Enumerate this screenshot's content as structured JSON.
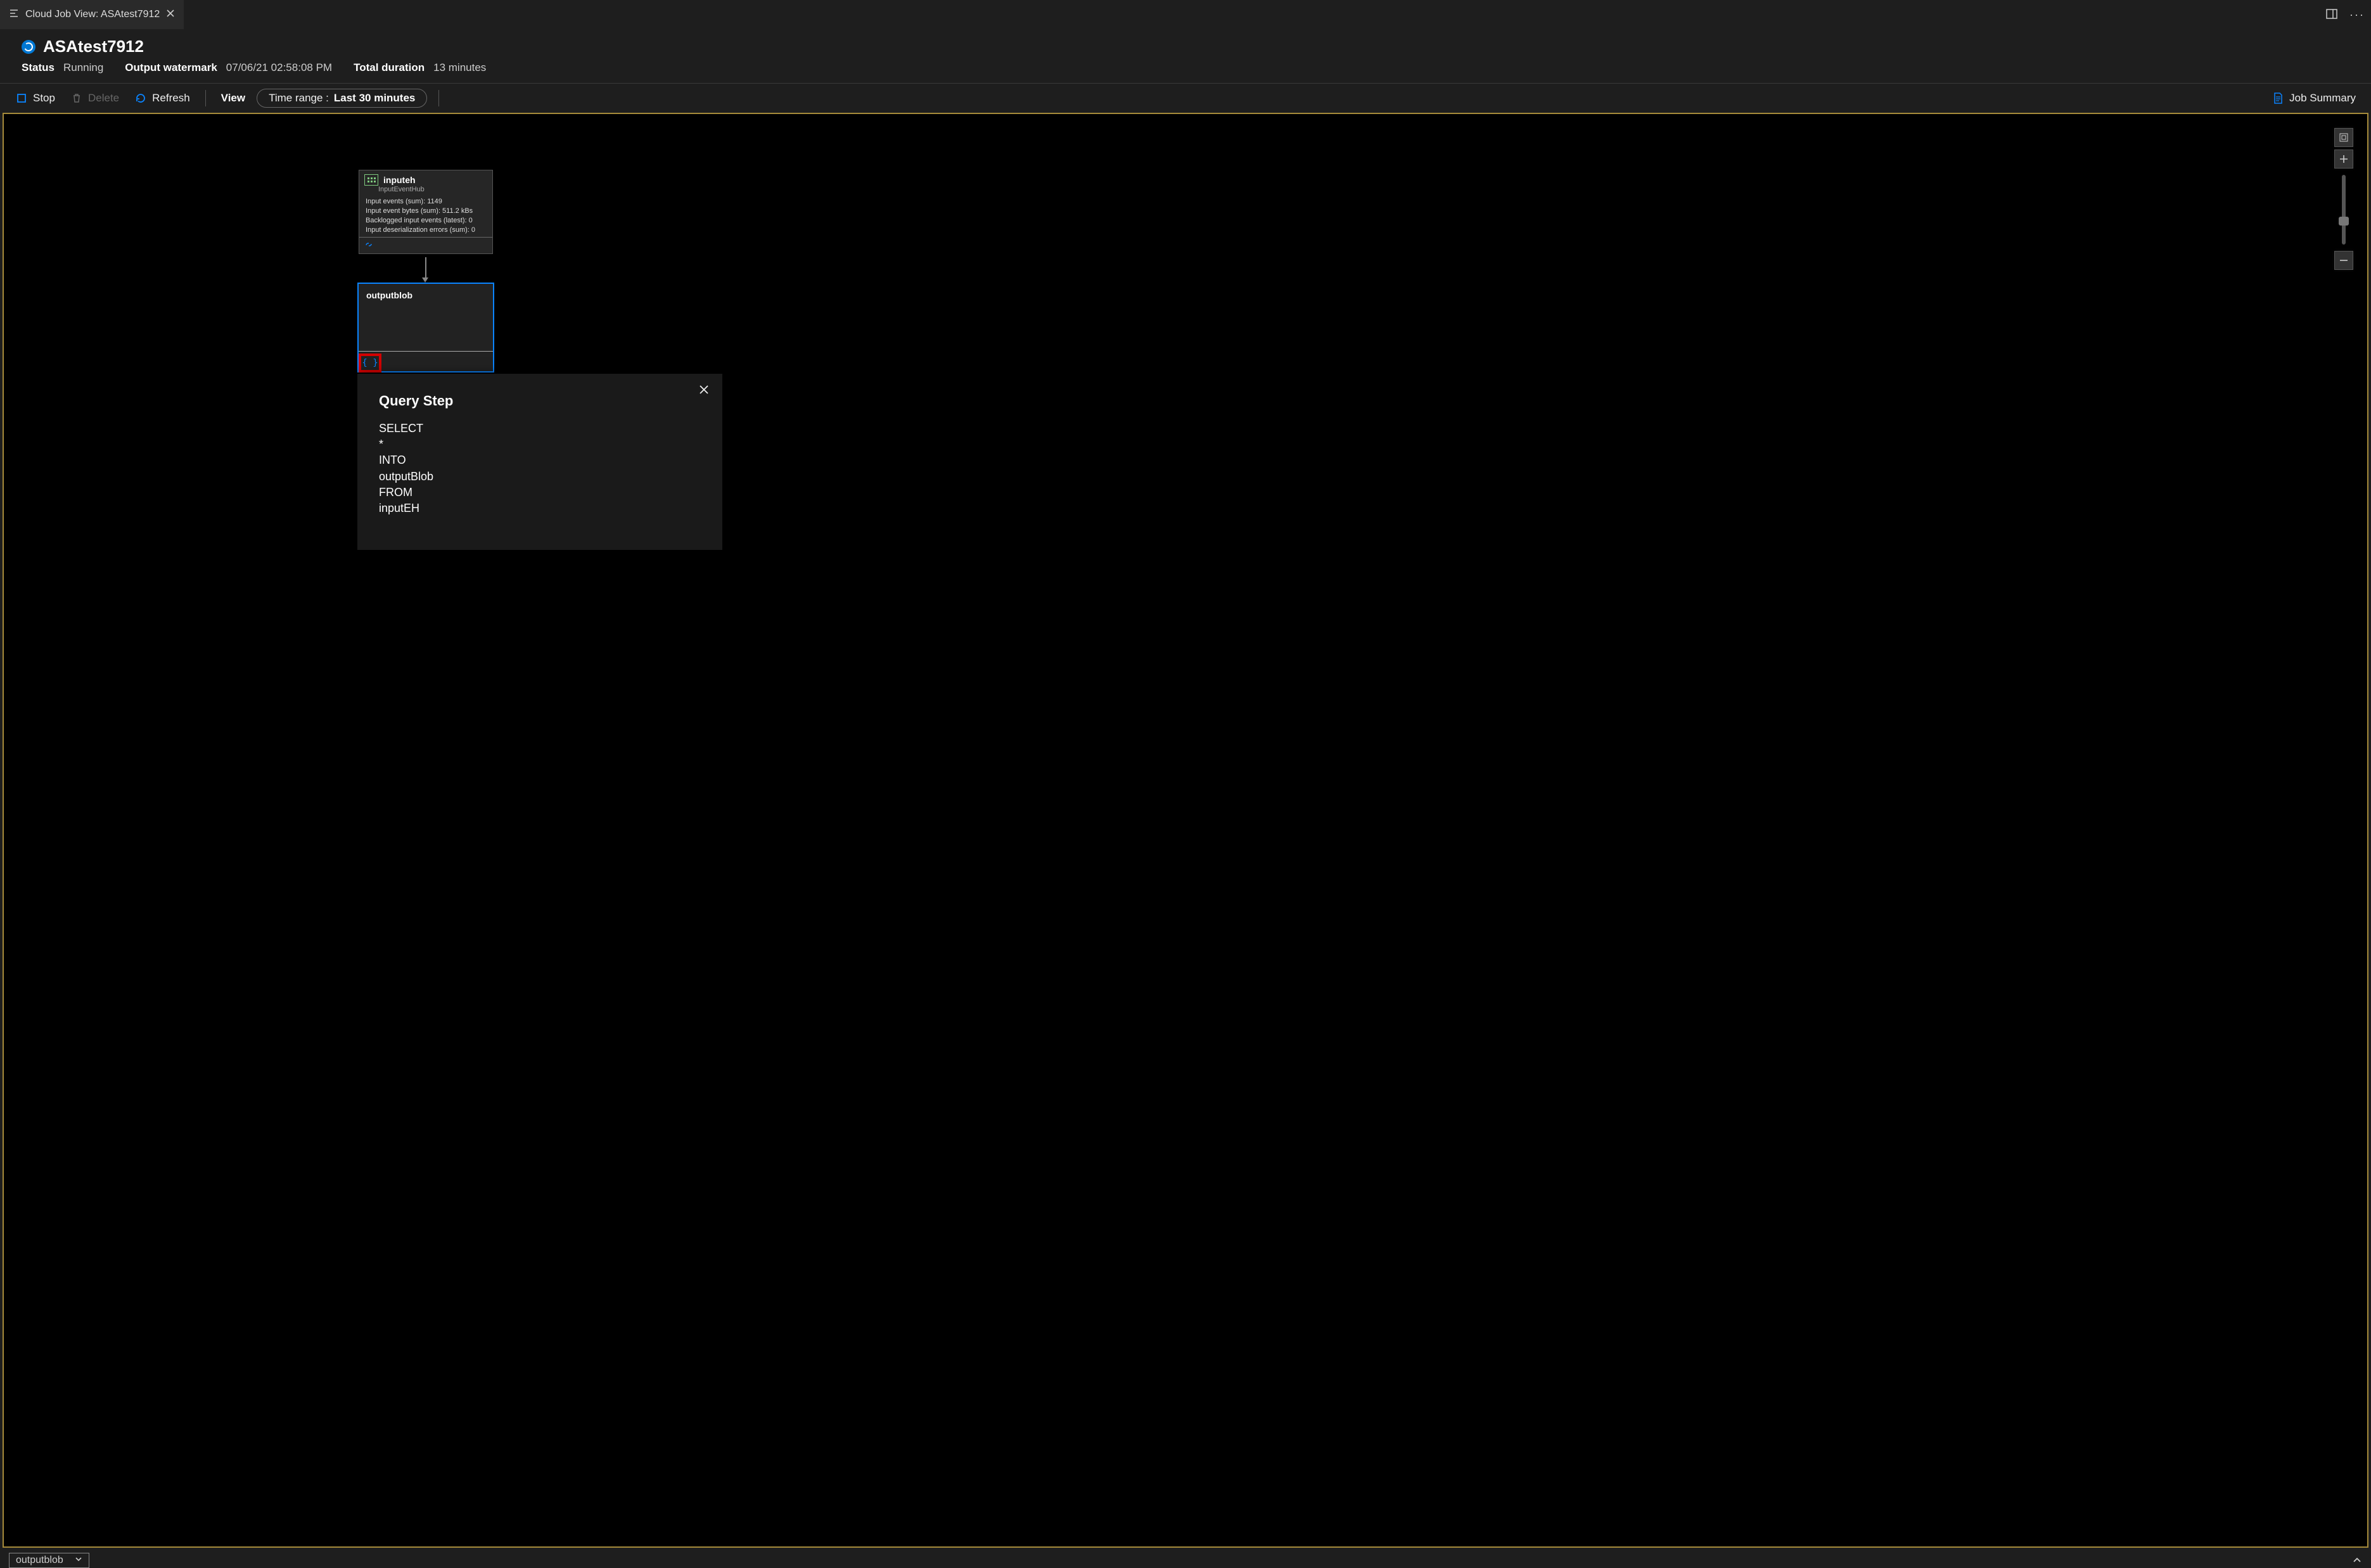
{
  "tab": {
    "title": "Cloud Job View: ASAtest7912"
  },
  "header": {
    "title": "ASAtest7912",
    "status_label": "Status",
    "status_value": "Running",
    "watermark_label": "Output watermark",
    "watermark_value": "07/06/21 02:58:08 PM",
    "duration_label": "Total duration",
    "duration_value": "13 minutes"
  },
  "toolbar": {
    "stop": "Stop",
    "delete": "Delete",
    "refresh": "Refresh",
    "view": "View",
    "time_range_label": "Time range :",
    "time_range_value": "Last 30 minutes",
    "summary": "Job Summary"
  },
  "nodes": {
    "input": {
      "name": "inputeh",
      "subtype": "InputEventHub",
      "metrics": [
        "Input events (sum): 1149",
        "Input event bytes (sum): 511.2 kBs",
        "Backlogged input events (latest): 0",
        "Input deserialization errors (sum): 0"
      ]
    },
    "output": {
      "name": "outputblob"
    }
  },
  "query": {
    "title": "Query Step",
    "lines": [
      "SELECT",
      "*",
      "INTO",
      "outputBlob",
      "FROM",
      "inputEH"
    ]
  },
  "bottom": {
    "dropdown": "outputblob"
  },
  "icons": {
    "script_braces": "{ }"
  }
}
